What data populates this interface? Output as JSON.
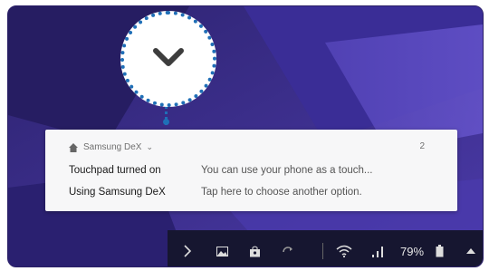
{
  "colors": {
    "wallpaper": "#3b2c8c",
    "notification_bg": "#f7f7f8",
    "callout": "#1f6fb7",
    "taskbar": "#161630"
  },
  "notification": {
    "app_name": "Samsung DeX",
    "count": "2",
    "rows": [
      {
        "title": "Touchpad turned on",
        "text": "You can use your phone as a touch..."
      },
      {
        "title": "Using Samsung DeX",
        "text": "Tap here to choose another option."
      }
    ]
  },
  "callout": {
    "icon": "chevron-down-icon"
  },
  "taskbar": {
    "icons": [
      "chevron-right-icon",
      "image-icon",
      "bag-icon",
      "sync-icon",
      "wifi-icon",
      "signal-icon",
      "battery-icon",
      "caret-up-icon"
    ],
    "battery_text": "79%"
  }
}
